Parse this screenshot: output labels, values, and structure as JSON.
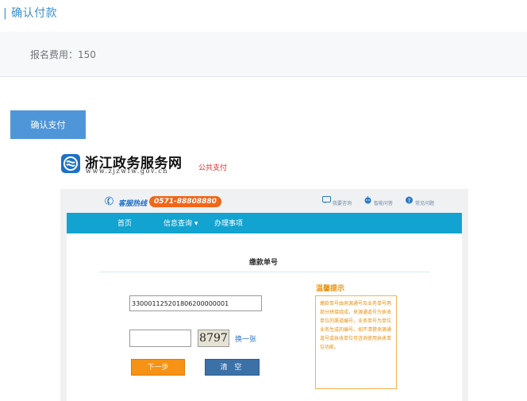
{
  "section": {
    "title": "| 确认付款"
  },
  "fee": {
    "text": "报名费用：150"
  },
  "confirm_button": {
    "label": "确认支付"
  },
  "portal": {
    "site_name": "浙江政务服务网",
    "site_url": "www.zjzwfw.gov.cn",
    "public_payment": "公共支付",
    "hotline": {
      "label": "客服热线",
      "number": "0571-88808880"
    },
    "top_links": [
      {
        "label": "我要咨询",
        "icon": "chat-icon"
      },
      {
        "label": "智能问答",
        "icon": "robot-icon"
      },
      {
        "label": "常见问题",
        "icon": "help-icon"
      }
    ],
    "nav": [
      {
        "label": "首页"
      },
      {
        "label": "信息查询 ▾"
      },
      {
        "label": "办理事项"
      }
    ],
    "form": {
      "title": "缴款单号",
      "order_number": "330001125201806200000001",
      "captcha_input": "",
      "captcha_text": "8797",
      "refresh_label": "换一张",
      "next_label": "下一步",
      "clear_label": "清 空"
    },
    "tips": {
      "title": "温馨提示",
      "text": "缴款单号由来源通号及业务单号两部分拼接组成，来源通道号为执收单位的渠道编号，业务单号为单位业务生成的编号，如不清楚来源通道号或执收单位可咨询使用执收单位功能。"
    }
  },
  "colors": {
    "accent": "#4f96d8",
    "nav": "#12a3d0",
    "orange": "#f69214",
    "hotline": "#f0661a"
  }
}
